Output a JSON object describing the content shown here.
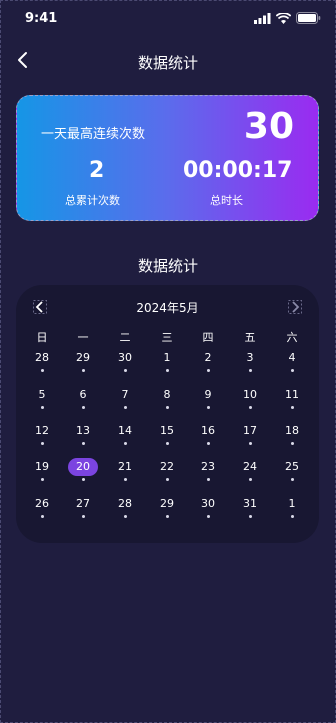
{
  "status": {
    "time": "9:41"
  },
  "nav": {
    "title": "数据统计"
  },
  "card": {
    "label_top": "一天最高连续次数",
    "top_value": "30",
    "total_count": "2",
    "total_count_label": "总累计次数",
    "total_time": "00:00:17",
    "total_time_label": "总时长"
  },
  "section_title": "数据统计",
  "calendar": {
    "month": "2024年5月",
    "weekdays": [
      "日",
      "一",
      "二",
      "三",
      "四",
      "五",
      "六"
    ],
    "weeks": [
      [
        "28",
        "29",
        "30",
        "1",
        "2",
        "3",
        "4"
      ],
      [
        "5",
        "6",
        "7",
        "8",
        "9",
        "10",
        "11"
      ],
      [
        "12",
        "13",
        "14",
        "15",
        "16",
        "17",
        "18"
      ],
      [
        "19",
        "20",
        "21",
        "22",
        "23",
        "24",
        "25"
      ],
      [
        "26",
        "27",
        "28",
        "29",
        "30",
        "31",
        "1"
      ]
    ],
    "selected": "20"
  },
  "colors": {
    "accent": "#7b44e0",
    "background": "#1f1d3f",
    "panel": "#181732"
  }
}
